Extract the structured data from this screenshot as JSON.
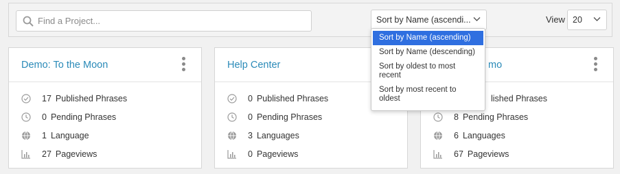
{
  "search": {
    "placeholder": "Find a Project..."
  },
  "sort": {
    "selected": "Sort by Name (ascendi...",
    "options": [
      "Sort by Name (ascending)",
      "Sort by Name (descending)",
      "Sort by oldest to most recent",
      "Sort by most recent to oldest"
    ]
  },
  "view": {
    "label": "View",
    "value": "20"
  },
  "colors": {
    "accent": "#2a8ab8",
    "selected": "#2f6fe0"
  },
  "projects": [
    {
      "title": "Demo: To the Moon",
      "published": "17",
      "published_label": "Published Phrases",
      "pending": "0",
      "pending_label": "Pending Phrases",
      "languages": "1",
      "languages_label": "Language",
      "pageviews": "27",
      "pageviews_label": "Pageviews"
    },
    {
      "title": "Help Center",
      "published": "0",
      "published_label": "Published Phrases",
      "pending": "0",
      "pending_label": "Pending Phrases",
      "languages": "3",
      "languages_label": "Languages",
      "pageviews": "0",
      "pageviews_label": "Pageviews"
    },
    {
      "title": "mo",
      "published": "",
      "published_label": "lished Phrases",
      "pending": "8",
      "pending_label": "Pending Phrases",
      "languages": "6",
      "languages_label": "Languages",
      "pageviews": "67",
      "pageviews_label": "Pageviews"
    }
  ]
}
